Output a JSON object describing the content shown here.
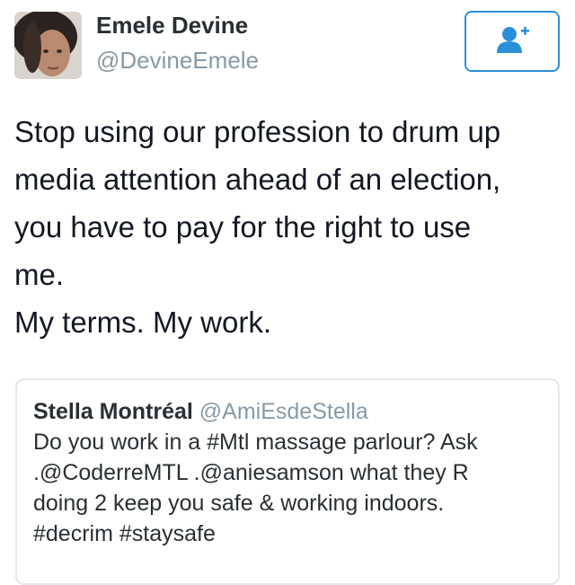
{
  "user": {
    "display_name": "Emele Devine",
    "handle": "@DevineEmele",
    "follow_icon": "add-user-icon"
  },
  "colors": {
    "accent": "#2b8fd8",
    "handle_gray": "#8899a6",
    "text": "#141823",
    "card_border": "#e1e8ed"
  },
  "tweet": {
    "lines": [
      "Stop using our profession to drum up",
      "media attention ahead of an election,",
      "you have to pay for the right to use",
      "me.",
      "My terms. My work."
    ]
  },
  "quoted_tweet": {
    "display_name": "Stella Montréal",
    "handle": "@AmiEsdeStella",
    "lines": [
      "Do you work in a #Mtl massage parlour? Ask",
      ".@CoderreMTL .@aniesamson what they R",
      "doing 2 keep you safe & working indoors.",
      "#decrim #staysafe"
    ]
  }
}
